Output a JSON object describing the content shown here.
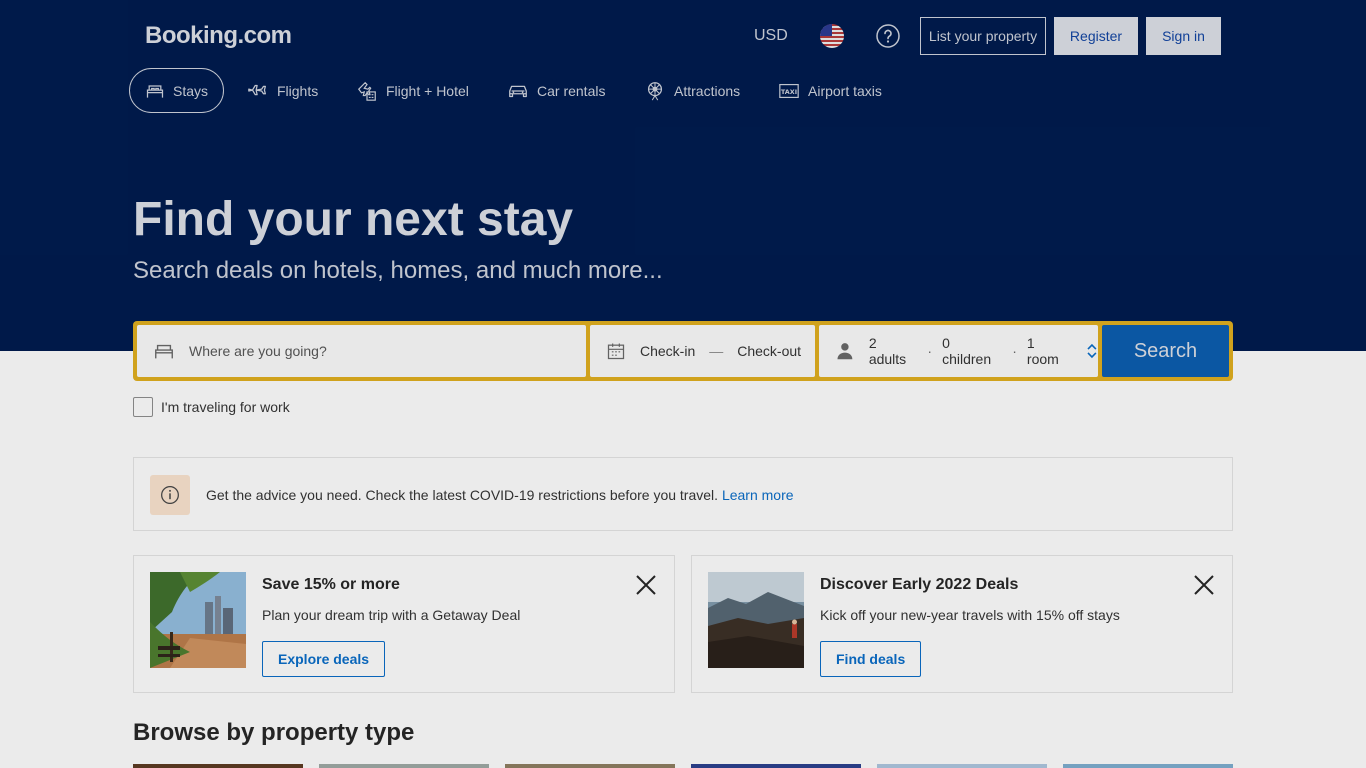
{
  "header": {
    "logo": "Booking.com",
    "currency": "USD",
    "list_property": "List your property",
    "register": "Register",
    "sign_in": "Sign in"
  },
  "nav": {
    "items": [
      {
        "label": "Stays",
        "icon": "bed-icon",
        "active": true
      },
      {
        "label": "Flights",
        "icon": "plane-icon"
      },
      {
        "label": "Flight + Hotel",
        "icon": "flight-hotel-icon"
      },
      {
        "label": "Car rentals",
        "icon": "car-icon"
      },
      {
        "label": "Attractions",
        "icon": "attractions-icon"
      },
      {
        "label": "Airport taxis",
        "icon": "taxi-icon"
      }
    ]
  },
  "hero": {
    "title": "Find your next stay",
    "subtitle": "Search deals on hotels, homes, and much more..."
  },
  "search": {
    "destination_placeholder": "Where are you going?",
    "check_in": "Check-in",
    "separator": "—",
    "check_out": "Check-out",
    "adults": "2 adults",
    "children": "0 children",
    "rooms": "1 room",
    "dot": "·",
    "button": "Search"
  },
  "work_travel": {
    "label": "I'm traveling for work"
  },
  "covid": {
    "text": "Get the advice you need. Check the latest COVID-19 restrictions before you travel.",
    "link": "Learn more"
  },
  "cards": [
    {
      "title": "Save 15% or more",
      "text": "Plan your dream trip with a Getaway Deal",
      "button": "Explore deals"
    },
    {
      "title": "Discover Early 2022 Deals",
      "text": "Kick off your new-year travels with 15% off stays",
      "button": "Find deals"
    }
  ],
  "browse": {
    "title": "Browse by property type"
  },
  "colors": {
    "hero_bg": "#001b4d",
    "search_border": "#d9a91f",
    "search_button": "#0c5baa",
    "link": "#0a6ac2"
  }
}
